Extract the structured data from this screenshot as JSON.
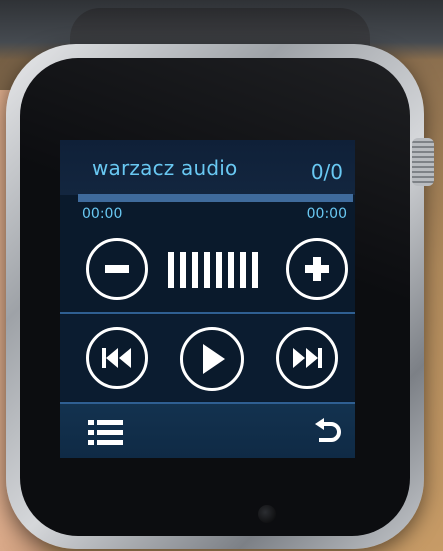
{
  "player": {
    "title": "warzacz audio",
    "track_count": "0/0",
    "time_elapsed": "00:00",
    "time_total": "00:00",
    "progress": 0,
    "volume_level_bars": 8
  },
  "icons": {
    "volume_down": "minus-circle-icon",
    "volume_up": "plus-circle-icon",
    "previous": "skip-previous-icon",
    "play": "play-icon",
    "next": "skip-next-icon",
    "playlist": "list-icon",
    "back": "back-arrow-icon"
  },
  "colors": {
    "accent_text": "#69c8f2",
    "screen_bg": "#0a1a2c",
    "progress_track": "#3f6b9c",
    "divider": "#2f5f92",
    "icon": "#ffffff"
  }
}
